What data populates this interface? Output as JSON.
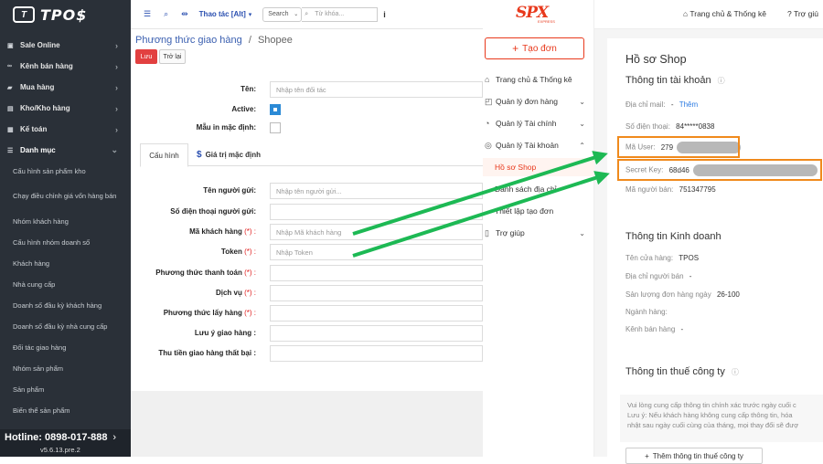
{
  "tpos": {
    "logo_mark": "T",
    "logo_text": "TPO$",
    "menu": [
      {
        "label": "Sale Online",
        "icon": "cart-icon"
      },
      {
        "label": "Kênh bán hàng",
        "icon": "link-icon"
      },
      {
        "label": "Mua hàng",
        "icon": "truck-icon"
      },
      {
        "label": "Kho/Kho hàng",
        "icon": "box-icon"
      },
      {
        "label": "Kế toán",
        "icon": "briefcase-icon"
      },
      {
        "label": "Danh mục",
        "icon": "list-icon"
      }
    ],
    "submenu": [
      "Cấu hình sản phẩm kho",
      "Chạy điều chỉnh giá vốn hàng bán",
      "Nhóm khách hàng",
      "Cấu hình nhóm doanh số",
      "Khách hàng",
      "Nhà cung cấp",
      "Doanh số đầu kỳ khách hàng",
      "Doanh số đầu kỳ nhà cung cấp",
      "Đối tác giao hàng",
      "Nhóm sản phẩm",
      "Sản phẩm",
      "Biến thể sản phẩm"
    ],
    "hotline": "Hotline: 0898-017-888",
    "version": "v5.6.13.pre.2",
    "topbar": {
      "action_label": "Thao tác [Alt]",
      "search_select": "Search",
      "keyword_placeholder": "Từ khóa..."
    },
    "breadcrumb": {
      "parent": "Phương thức giao hàng",
      "separator": "/",
      "current": "Shopee"
    },
    "save_label": "Lưu",
    "back_label": "Trở lại",
    "form_top": {
      "name_label": "Tên:",
      "name_placeholder": "Nhập tên đối tác",
      "active_label": "Active:",
      "active_checked": true,
      "default_print_label": "Mẫu in mặc định:"
    },
    "tabs": {
      "config": "Cấu hình",
      "default_values": "Giá trị mặc định",
      "dollar": "$"
    },
    "form_fields": {
      "sender_name_label": "Tên người gửi:",
      "sender_name_placeholder": "Nhập tên người gửi...",
      "sender_phone_label": "Số điện thoại người gửi:",
      "customer_code_label": "Mã khách hàng",
      "customer_code_placeholder": "Nhập Mã khách hàng",
      "token_label": "Token",
      "token_placeholder": "Nhập Token",
      "payment_label": "Phương thức thanh toán",
      "service_label": "Dịch vụ",
      "pickup_label": "Phương thức lấy hàng",
      "note_label": "Lưu ý giao hàng :",
      "failed_fee_label": "Thu tiền giao hàng thất bại :",
      "required_mark": "(*) :"
    }
  },
  "spx": {
    "logo": "SPX",
    "logo_sub": "EXPRESS",
    "create_order": "Tạo đơn",
    "nav": [
      {
        "label": "Trang chủ & Thống kê",
        "icon": "home-icon"
      },
      {
        "label": "Quản lý đơn hàng",
        "icon": "order-icon",
        "chevron": "⌄"
      },
      {
        "label": "Quản lý Tài chính",
        "icon": "finance-icon",
        "chevron": "⌄"
      },
      {
        "label": "Quản lý Tài khoản",
        "icon": "account-icon",
        "chevron": "⌃"
      }
    ],
    "account_sub": [
      "Hồ sơ Shop",
      "Danh sách địa chỉ",
      "Thiết lập tạo đơn"
    ],
    "help_nav": "Trợ giúp",
    "topbar": {
      "home": "Trang chủ & Thống kê",
      "help": "Trợ giú"
    },
    "profile": {
      "title": "Hồ sơ Shop",
      "account_section": "Thông tin tài khoản",
      "email_label": "Địa chỉ mail:",
      "email_action": "Thêm",
      "email_dash": "-",
      "phone_label": "Số điện thoại:",
      "phone_value": "84*****0838",
      "user_code_label": "Mã User:",
      "user_code_value": "279",
      "secret_key_label": "Secret Key:",
      "secret_key_value": "68d46",
      "seller_code_label": "Mã người bán:",
      "seller_code_value": "751347795",
      "business_section": "Thông tin Kinh doanh",
      "shop_name_label": "Tên cửa hàng:",
      "shop_name_value": "TPOS",
      "seller_address_label": "Địa chỉ người bán",
      "seller_address_value": "-",
      "daily_volume_label": "Sản lượng đơn hàng ngày",
      "daily_volume_value": "26-100",
      "industry_label": "Ngành hàng:",
      "channel_label": "Kênh bán hàng",
      "channel_value": "-",
      "tax_section": "Thông tin thuế công ty",
      "tax_note_1": "Vui lòng cung cấp thông tin chính xác trước ngày cuối c",
      "tax_note_2": "Lưu ý: Nếu khách hàng không cung cấp thông tin, hóa",
      "tax_note_3": "nhật sau ngày cuối cùng của tháng, mọi thay đổi sẽ đượ",
      "add_tax_button": "Thêm thông tin thuế công ty"
    }
  },
  "colors": {
    "arrow": "#1db954",
    "highlight": "#f08a1c",
    "spx_brand": "#e8391c",
    "tpos_sidebar": "#2a3038"
  }
}
